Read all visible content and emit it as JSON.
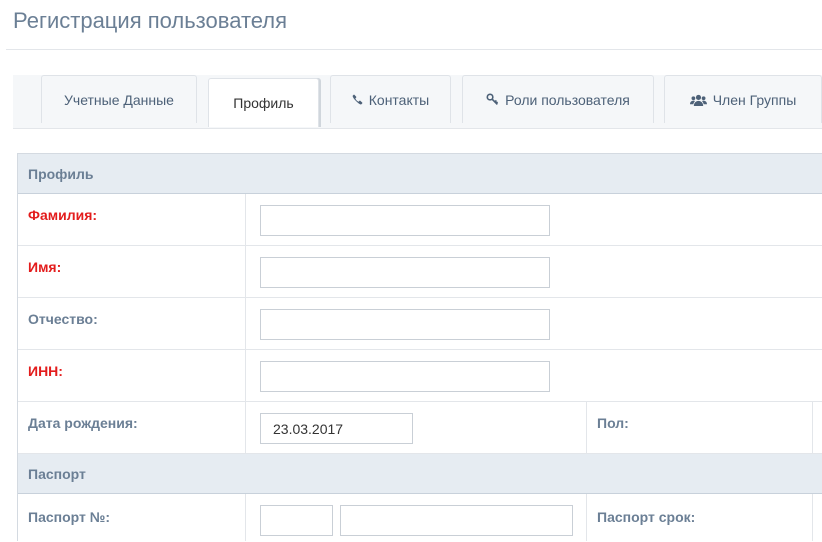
{
  "page": {
    "title": "Регистрация пользователя"
  },
  "tabs": [
    {
      "label": "Учетные Данные",
      "icon": ""
    },
    {
      "label": "Профиль",
      "icon": "",
      "active": true
    },
    {
      "label": "Контакты",
      "icon": "phone-icon"
    },
    {
      "label": "Роли пользователя",
      "icon": "key-icon"
    },
    {
      "label": "Член Группы",
      "icon": "users-icon"
    }
  ],
  "profile": {
    "section_title": "Профиль",
    "last_name_label": "Фамилия:",
    "first_name_label": "Имя:",
    "patronymic_label": "Отчество:",
    "inn_label": "ИНН:",
    "birth_date_label": "Дата рождения:",
    "birth_date_value": "23.03.2017",
    "gender_label": "Пол:"
  },
  "passport": {
    "section_title": "Паспорт",
    "number_label": "Паспорт №:",
    "term_label": "Паспорт срок:"
  },
  "colors": {
    "required_label": "#e31c1c",
    "label": "#6b7f95",
    "section_bg": "#e6ecf2"
  }
}
